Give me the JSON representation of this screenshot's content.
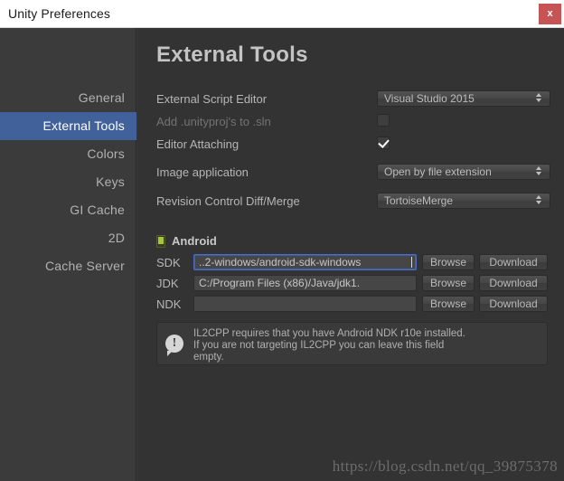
{
  "window": {
    "title": "Unity Preferences",
    "close_label": "x",
    "close_color": "#c65454"
  },
  "sidebar": {
    "selected_color": "#40619a",
    "items": [
      {
        "label": "General",
        "selected": false
      },
      {
        "label": "External Tools",
        "selected": true
      },
      {
        "label": "Colors",
        "selected": false
      },
      {
        "label": "Keys",
        "selected": false
      },
      {
        "label": "GI Cache",
        "selected": false
      },
      {
        "label": "2D",
        "selected": false
      },
      {
        "label": "Cache Server",
        "selected": false
      }
    ]
  },
  "main": {
    "title": "External Tools",
    "rows": [
      {
        "label": "External Script Editor",
        "value": "Visual Studio 2015",
        "control": "dropdown"
      },
      {
        "label": "Add .unityproj's to .sln",
        "value": "",
        "control": "checkbox-unchecked"
      },
      {
        "label": "Editor Attaching",
        "value": "",
        "control": "checkbox-checked"
      },
      {
        "label": "Image application",
        "value": "Open by file extension",
        "control": "dropdown"
      },
      {
        "label": "Revision Control Diff/Merge",
        "value": "TortoiseMerge",
        "control": "dropdown"
      }
    ],
    "android": {
      "header": "Android",
      "browse_label": "Browse",
      "download_label": "Download",
      "paths": [
        {
          "label": "SDK",
          "value": "..2-windows/android-sdk-windows",
          "focused": true
        },
        {
          "label": "JDK",
          "value": "C:/Program Files (x86)/Java/jdk1.",
          "focused": false
        },
        {
          "label": "NDK",
          "value": "",
          "focused": false
        }
      ]
    },
    "info": {
      "text": "IL2CPP requires that you have Android NDK r10e installed.\nIf you are not targeting IL2CPP you can leave this field\nempty."
    }
  },
  "watermark": {
    "text": "https://blog.csdn.net/qq_39875378"
  }
}
